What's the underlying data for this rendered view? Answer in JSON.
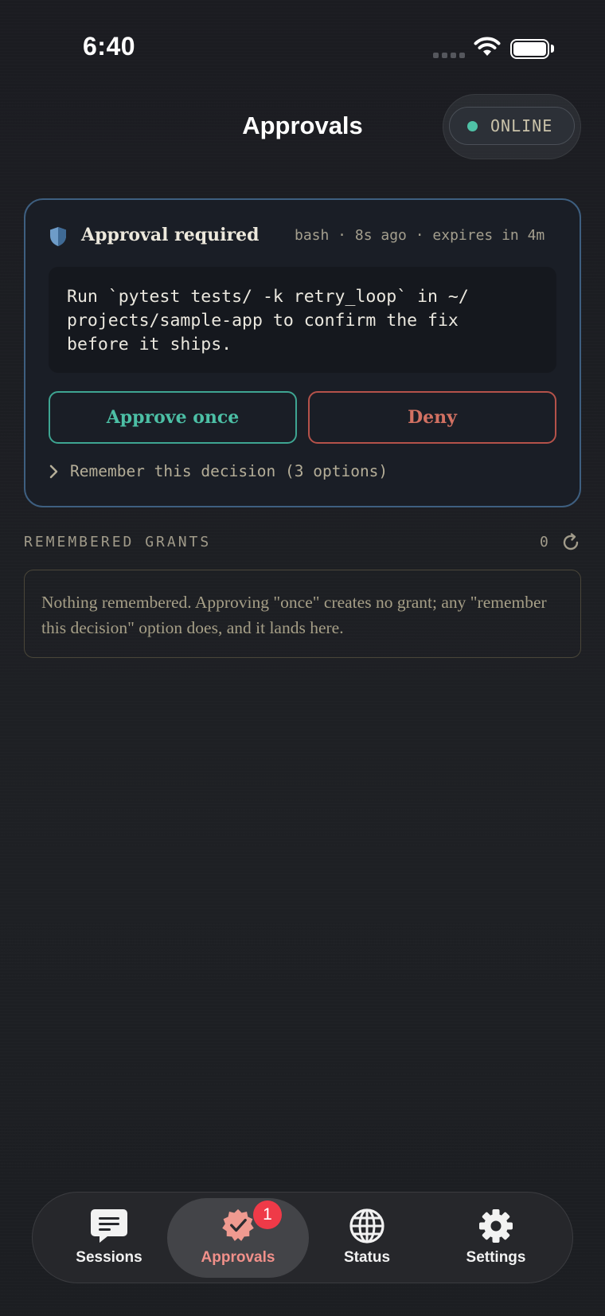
{
  "status_bar": {
    "time": "6:40"
  },
  "header": {
    "title": "Approvals",
    "connection_status": "ONLINE"
  },
  "colors": {
    "accent_teal": "#4cbfa5",
    "deny_red": "#d27162",
    "card_border": "#3e5f80",
    "badge_red": "#ef3a48",
    "active_tab": "#f1908a"
  },
  "approval_card": {
    "title": "Approval required",
    "meta": "bash · 8s ago · expires in 4m",
    "command_text": "Run `pytest tests/ -k retry_loop` in ~/\nprojects/sample-app to confirm the fix\nbefore it ships.",
    "approve_label": "Approve once",
    "deny_label": "Deny",
    "remember_label": "Remember this decision (3 options)"
  },
  "grants": {
    "header": "REMEMBERED GRANTS",
    "count": "0",
    "empty_text": "Nothing remembered. Approving \"once\" creates no grant; any \"remember this decision\" option does, and it lands here."
  },
  "tabs": [
    {
      "label": "Sessions",
      "icon": "chat-bubble-icon"
    },
    {
      "label": "Approvals",
      "icon": "check-badge-icon",
      "badge": "1",
      "active": true
    },
    {
      "label": "Status",
      "icon": "globe-icon"
    },
    {
      "label": "Settings",
      "icon": "gear-icon"
    }
  ]
}
